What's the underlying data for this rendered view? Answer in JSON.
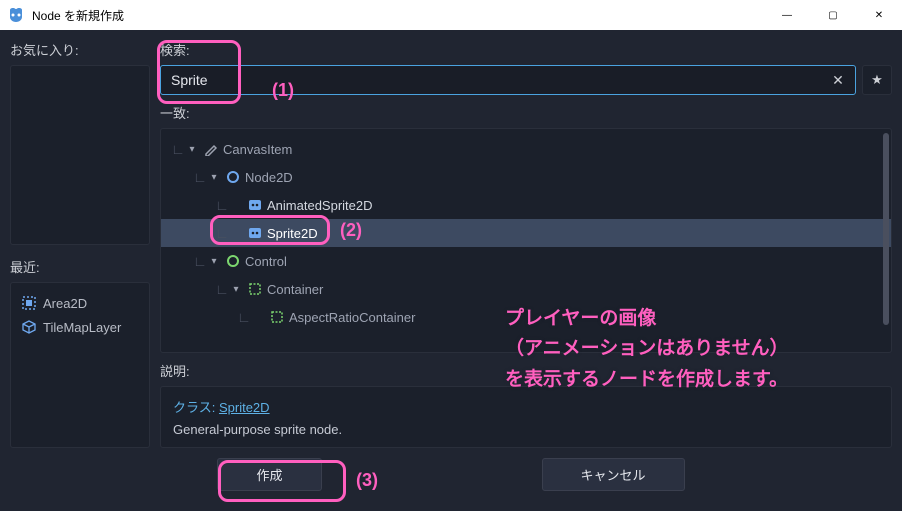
{
  "window": {
    "title": "Node を新規作成",
    "min_label": "—",
    "max_label": "▢",
    "close_label": "✕"
  },
  "left": {
    "favorites_label": "お気に入り:",
    "recent_label": "最近:",
    "recent_items": [
      {
        "name": "Area2D",
        "icon": "area2d-icon"
      },
      {
        "name": "TileMapLayer",
        "icon": "tilemap-icon"
      }
    ]
  },
  "search": {
    "label": "検索:",
    "value": "Sprite",
    "clear_glyph": "✕",
    "star_glyph": "★"
  },
  "match_label": "一致:",
  "tree": [
    {
      "indent": 0,
      "name": "CanvasItem",
      "icon": "canvasitem-icon",
      "expanded": true,
      "match": false
    },
    {
      "indent": 1,
      "name": "Node2D",
      "icon": "node2d-icon",
      "expanded": true,
      "match": false
    },
    {
      "indent": 2,
      "name": "AnimatedSprite2D",
      "icon": "sprite-icon",
      "expanded": false,
      "match": true
    },
    {
      "indent": 2,
      "name": "Sprite2D",
      "icon": "sprite-icon",
      "expanded": false,
      "match": true,
      "selected": true
    },
    {
      "indent": 1,
      "name": "Control",
      "icon": "control-icon",
      "expanded": true,
      "match": false
    },
    {
      "indent": 2,
      "name": "Container",
      "icon": "container-icon",
      "expanded": true,
      "match": false
    },
    {
      "indent": 3,
      "name": "AspectRatioContainer",
      "icon": "container-icon",
      "expanded": false,
      "match": false
    }
  ],
  "description": {
    "label": "説明:",
    "class_prefix": "クラス: ",
    "class_name": "Sprite2D",
    "text": "General-purpose sprite node."
  },
  "footer": {
    "create_label": "作成",
    "cancel_label": "キャンセル"
  },
  "callouts": {
    "one": "(1)",
    "two": "(2)",
    "three": "(3)"
  },
  "annotation_text": "プレイヤーの画像\n（アニメーションはありません）\nを表示するノードを作成します。"
}
